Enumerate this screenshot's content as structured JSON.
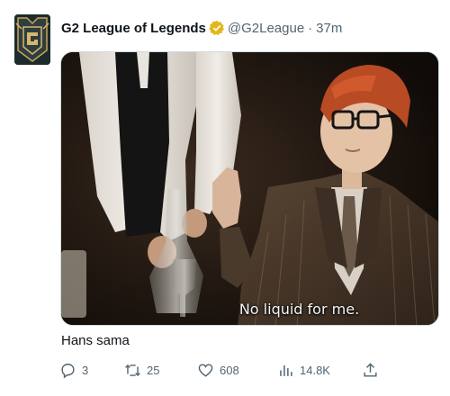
{
  "tweet": {
    "display_name": "G2 League of Legends",
    "handle": "@G2League",
    "separator": "·",
    "time": "37m",
    "text": "Hans sama",
    "media_caption": "No liquid for me."
  },
  "actions": {
    "replies": "3",
    "retweets": "25",
    "likes": "608",
    "views": "14.8K"
  },
  "colors": {
    "verified_badge": "#e2b719",
    "secondary_text": "#536471",
    "primary_text": "#0f1419"
  },
  "icons": [
    "verified-badge-icon",
    "reply-icon",
    "retweet-icon",
    "like-icon",
    "views-icon",
    "share-icon"
  ]
}
